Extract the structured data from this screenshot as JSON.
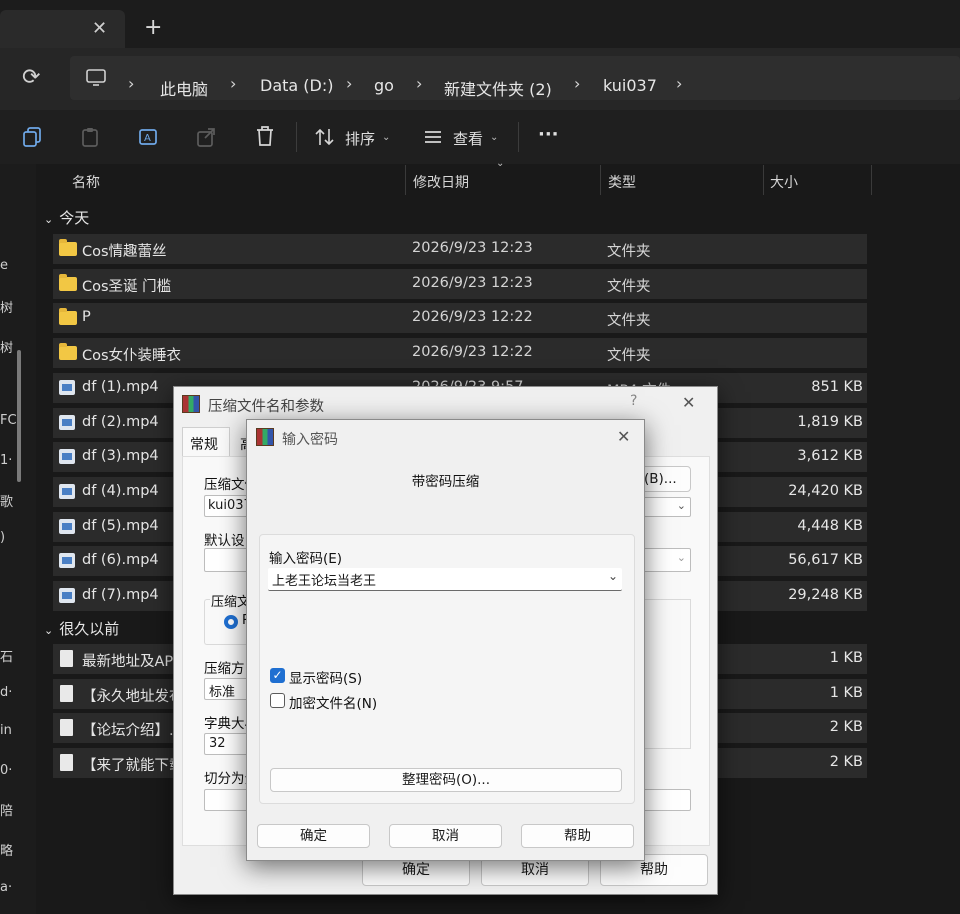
{
  "tabbar": {
    "close_icon": "✕",
    "new_icon": "+"
  },
  "address": {
    "refresh_icon": "⟳",
    "computer_icon": "monitor-icon",
    "crumbs": [
      "此电脑",
      "Data (D:)",
      "go",
      "新建文件夹 (2)",
      "kui037"
    ]
  },
  "toolbar": {
    "sort_label": "排序",
    "view_label": "查看",
    "more_label": "···"
  },
  "nav_glyphs": [
    "e",
    "树",
    "树",
    "FC",
    "1·",
    "歌",
    ")",
    "石",
    "d·",
    "in",
    "0·",
    "陪",
    "略",
    "a·"
  ],
  "columns": {
    "name": "名称",
    "modified": "修改日期",
    "type": "类型",
    "size": "大小"
  },
  "groups": {
    "today": "今天",
    "long_ago": "很久以前"
  },
  "files_today": [
    {
      "name": "Cos情趣蕾丝",
      "date": "2026/9/23 12:23",
      "type": "文件夹",
      "size": "",
      "kind": "folder"
    },
    {
      "name": "Cos圣诞 门槛",
      "date": "2026/9/23 12:23",
      "type": "文件夹",
      "size": "",
      "kind": "folder"
    },
    {
      "name": "P",
      "date": "2026/9/23 12:22",
      "type": "文件夹",
      "size": "",
      "kind": "folder"
    },
    {
      "name": "Cos女仆装睡衣",
      "date": "2026/9/23 12:22",
      "type": "文件夹",
      "size": "",
      "kind": "folder"
    },
    {
      "name": "df (1).mp4",
      "date": "2026/9/23 9:57",
      "type": "MP4 文件",
      "size": "851 KB",
      "kind": "video"
    },
    {
      "name": "df (2).mp4",
      "date": "",
      "type": "",
      "size": "1,819 KB",
      "kind": "video"
    },
    {
      "name": "df (3).mp4",
      "date": "",
      "type": "",
      "size": "3,612 KB",
      "kind": "video"
    },
    {
      "name": "df (4).mp4",
      "date": "",
      "type": "",
      "size": "24,420 KB",
      "kind": "video"
    },
    {
      "name": "df (5).mp4",
      "date": "",
      "type": "",
      "size": "4,448 KB",
      "kind": "video"
    },
    {
      "name": "df (6).mp4",
      "date": "",
      "type": "",
      "size": "56,617 KB",
      "kind": "video"
    },
    {
      "name": "df (7).mp4",
      "date": "",
      "type": "",
      "size": "29,248 KB",
      "kind": "video"
    }
  ],
  "files_old": [
    {
      "name": "最新地址及AP",
      "size": "1 KB"
    },
    {
      "name": "【永久地址发布",
      "size": "1 KB"
    },
    {
      "name": "【论坛介绍】.",
      "size": "2 KB"
    },
    {
      "name": "【来了就能下载",
      "size": "2 KB"
    }
  ],
  "dialog_archive": {
    "title": "压缩文件名和参数",
    "help_glyph": "?",
    "close_glyph": "✕",
    "tab_general": "常规",
    "tab_next": "高",
    "archive_name_label": "压缩文件",
    "archive_name_value": "kui037",
    "browse_button": "(B)...",
    "default_profile_label": "默认设",
    "format_label": "压缩文",
    "format_option": "R",
    "method_label": "压缩方",
    "method_value": "标准",
    "dict_label": "字典大小",
    "dict_value": "32",
    "split_label": "切分为分",
    "ok": "确定",
    "cancel": "取消",
    "help": "帮助"
  },
  "dialog_password": {
    "title": "输入密码",
    "close_glyph": "✕",
    "subtitle": "带密码压缩",
    "password_label": "输入密码(E)",
    "password_value": "上老王论坛当老王",
    "show_password": "显示密码(S)",
    "encrypt_names": "加密文件名(N)",
    "organize_button": "整理密码(O)...",
    "ok": "确定",
    "cancel": "取消",
    "help": "帮助"
  }
}
